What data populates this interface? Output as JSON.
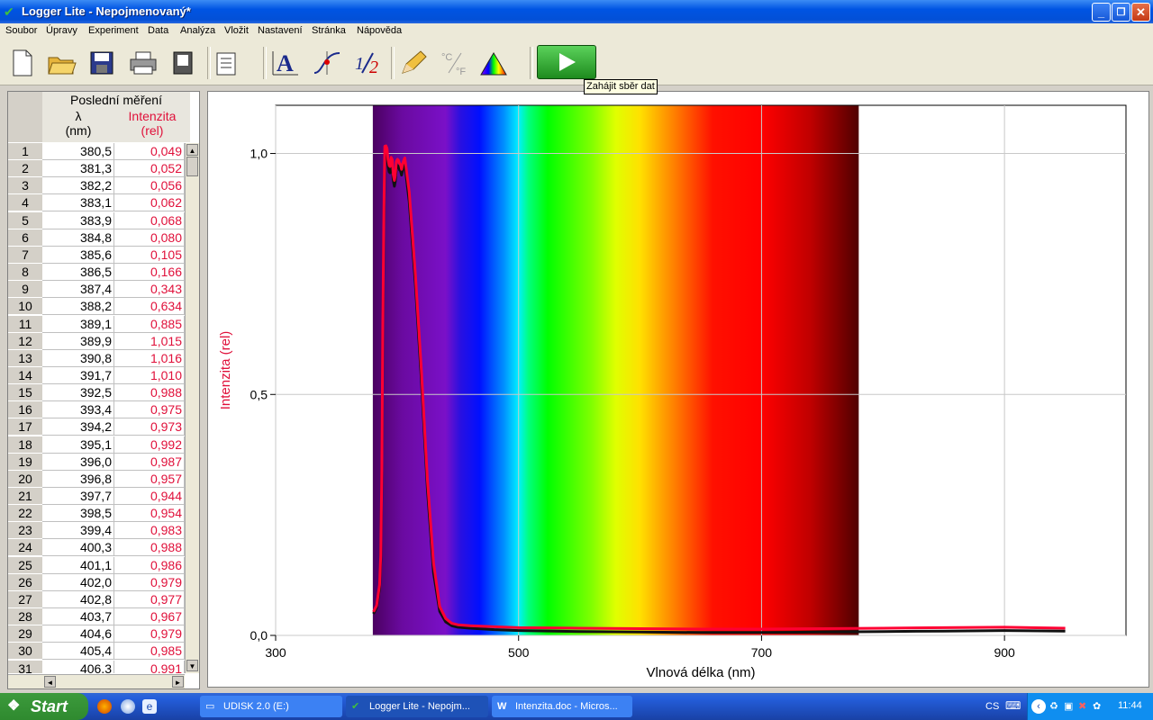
{
  "window": {
    "title": "Logger Lite - Nepojmenovaný*",
    "minimize": "_",
    "maximize": "❐",
    "close": "✕"
  },
  "menu": [
    "Soubor",
    "Úpravy",
    "Experiment",
    "Data",
    "Analýza",
    "Vložit",
    "Nastavení",
    "Stránka",
    "Nápověda"
  ],
  "toolbar": {
    "tooltip": "Zahájit sběr dat"
  },
  "table": {
    "group_header": "Poslední měření",
    "col1_header": "λ",
    "col1_unit": "(nm)",
    "col2_header": "Intenzita",
    "col2_unit": "(rel)",
    "rows": [
      [
        "1",
        "380,5",
        "0,049"
      ],
      [
        "2",
        "381,3",
        "0,052"
      ],
      [
        "3",
        "382,2",
        "0,056"
      ],
      [
        "4",
        "383,1",
        "0,062"
      ],
      [
        "5",
        "383,9",
        "0,068"
      ],
      [
        "6",
        "384,8",
        "0,080"
      ],
      [
        "7",
        "385,6",
        "0,105"
      ],
      [
        "8",
        "386,5",
        "0,166"
      ],
      [
        "9",
        "387,4",
        "0,343"
      ],
      [
        "10",
        "388,2",
        "0,634"
      ],
      [
        "11",
        "389,1",
        "0,885"
      ],
      [
        "12",
        "389,9",
        "1,015"
      ],
      [
        "13",
        "390,8",
        "1,016"
      ],
      [
        "14",
        "391,7",
        "1,010"
      ],
      [
        "15",
        "392,5",
        "0,988"
      ],
      [
        "16",
        "393,4",
        "0,975"
      ],
      [
        "17",
        "394,2",
        "0,973"
      ],
      [
        "18",
        "395,1",
        "0,992"
      ],
      [
        "19",
        "396,0",
        "0,987"
      ],
      [
        "20",
        "396,8",
        "0,957"
      ],
      [
        "21",
        "397,7",
        "0,944"
      ],
      [
        "22",
        "398,5",
        "0,954"
      ],
      [
        "23",
        "399,4",
        "0,983"
      ],
      [
        "24",
        "400,3",
        "0,988"
      ],
      [
        "25",
        "401,1",
        "0,986"
      ],
      [
        "26",
        "402,0",
        "0,979"
      ],
      [
        "27",
        "402,8",
        "0,977"
      ],
      [
        "28",
        "403,7",
        "0,967"
      ],
      [
        "29",
        "404,6",
        "0,979"
      ],
      [
        "30",
        "405,4",
        "0,985"
      ],
      [
        "31",
        "406,3",
        "0,991"
      ]
    ]
  },
  "chart_data": {
    "type": "line",
    "xlabel": "Vlnová délka (nm)",
    "ylabel": "Intenzita (rel)",
    "xlim": [
      300,
      1000
    ],
    "ylim": [
      0,
      1.1
    ],
    "x_ticks": [
      "300",
      "500",
      "700",
      "900"
    ],
    "x_tick_values": [
      300,
      500,
      700,
      900
    ],
    "y_ticks": [
      "0,0",
      "0,5",
      "1,0"
    ],
    "y_tick_values": [
      0,
      0.5,
      1.0
    ],
    "grid": true,
    "spectrum_band": [
      380,
      780
    ],
    "series": [
      {
        "color": "#ff0033",
        "x": [
          380.5,
          383.1,
          385.6,
          386.5,
          387.4,
          388.2,
          389.1,
          389.9,
          390.8,
          391.7,
          392.5,
          393.4,
          394.2,
          395.1,
          396.0,
          396.8,
          397.7,
          398.5,
          399.4,
          400.3,
          401.1,
          402.0,
          402.8,
          403.7,
          404.6,
          405.4,
          406.3,
          410,
          415,
          420,
          425,
          430,
          435,
          440,
          445,
          450,
          460,
          480,
          500,
          550,
          600,
          650,
          700,
          750,
          800,
          850,
          900,
          950
        ],
        "y": [
          0.049,
          0.062,
          0.105,
          0.166,
          0.343,
          0.634,
          0.885,
          1.015,
          1.016,
          1.01,
          0.988,
          0.975,
          0.973,
          0.992,
          0.987,
          0.957,
          0.944,
          0.954,
          0.983,
          0.988,
          0.986,
          0.979,
          0.977,
          0.967,
          0.979,
          0.985,
          0.991,
          0.92,
          0.75,
          0.55,
          0.32,
          0.15,
          0.06,
          0.035,
          0.025,
          0.022,
          0.02,
          0.018,
          0.016,
          0.015,
          0.014,
          0.013,
          0.013,
          0.014,
          0.015,
          0.016,
          0.017,
          0.015
        ]
      },
      {
        "color": "#111111",
        "x": [
          380.5,
          383.1,
          385.6,
          386.5,
          387.4,
          388.2,
          389.1,
          389.9,
          390.8,
          391.7,
          392.5,
          393.4,
          394.2,
          395.1,
          396.0,
          396.8,
          397.7,
          398.5,
          399.4,
          400.3,
          401.1,
          402.0,
          402.8,
          403.7,
          404.6,
          405.4,
          406.3,
          410,
          415,
          420,
          425,
          430,
          435,
          440,
          445,
          450,
          460,
          480,
          500,
          550,
          600,
          650,
          700,
          750,
          800,
          850,
          900,
          950
        ],
        "y": [
          0.045,
          0.058,
          0.098,
          0.155,
          0.33,
          0.62,
          0.87,
          1.0,
          1.005,
          0.998,
          0.975,
          0.962,
          0.96,
          0.98,
          0.975,
          0.945,
          0.932,
          0.942,
          0.97,
          0.975,
          0.973,
          0.966,
          0.964,
          0.955,
          0.966,
          0.972,
          0.978,
          0.9,
          0.73,
          0.53,
          0.3,
          0.13,
          0.05,
          0.028,
          0.02,
          0.017,
          0.015,
          0.012,
          0.01,
          0.008,
          0.007,
          0.006,
          0.006,
          0.007,
          0.008,
          0.009,
          0.01,
          0.009
        ]
      }
    ]
  },
  "taskbar": {
    "start": "Start",
    "tasks": [
      {
        "label": "UDISK 2.0 (E:)"
      },
      {
        "label": "Logger Lite - Nepojm..."
      },
      {
        "label": "Intenzita.doc - Micros..."
      }
    ],
    "lang": "CS",
    "clock": "11:44"
  }
}
